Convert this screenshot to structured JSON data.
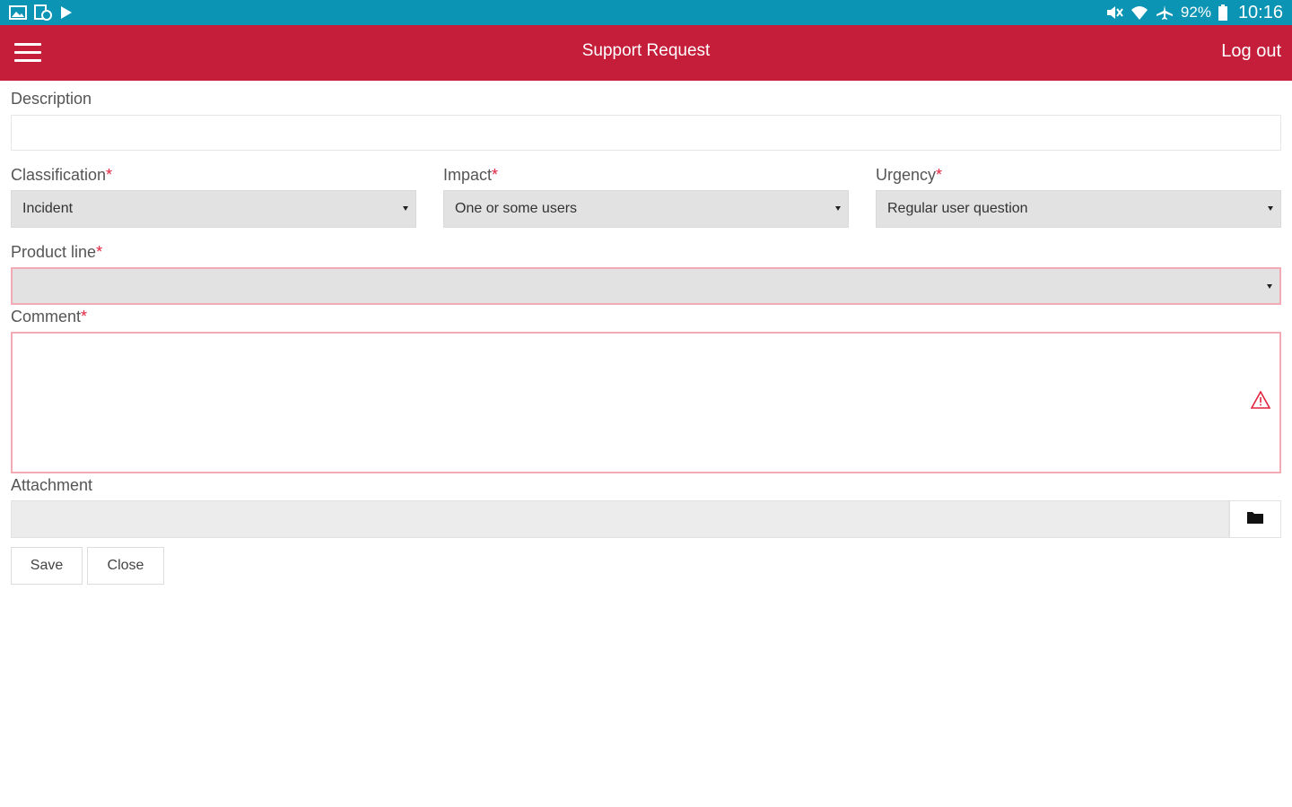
{
  "status_bar": {
    "left_icons": [
      "image-icon",
      "device-sync-icon",
      "play-store-icon"
    ],
    "right_icons": [
      "mute-icon",
      "wifi-icon",
      "airplane-icon",
      "battery-icon"
    ],
    "battery": "92%",
    "time": "10:16"
  },
  "header": {
    "title": "Support Request",
    "logout_label": "Log out",
    "menu_icon": "hamburger-icon",
    "color": "#c41e3a"
  },
  "form": {
    "description": {
      "label": "Description",
      "value": ""
    },
    "classification": {
      "label": "Classification",
      "required_mark": "*",
      "value": "Incident"
    },
    "impact": {
      "label": "Impact",
      "required_mark": "*",
      "value": "One or some users"
    },
    "urgency": {
      "label": "Urgency",
      "required_mark": "*",
      "value": "Regular user question"
    },
    "product_line": {
      "label": "Product line",
      "required_mark": "*",
      "value": ""
    },
    "comment": {
      "label": "Comment",
      "required_mark": "*",
      "value": ""
    },
    "attachment": {
      "label": "Attachment",
      "value": ""
    }
  },
  "actions": {
    "save_label": "Save",
    "close_label": "Close"
  },
  "colors": {
    "status_bar": "#0b94b4",
    "required": "#e0243f",
    "invalid_border": "#f2aab5"
  }
}
